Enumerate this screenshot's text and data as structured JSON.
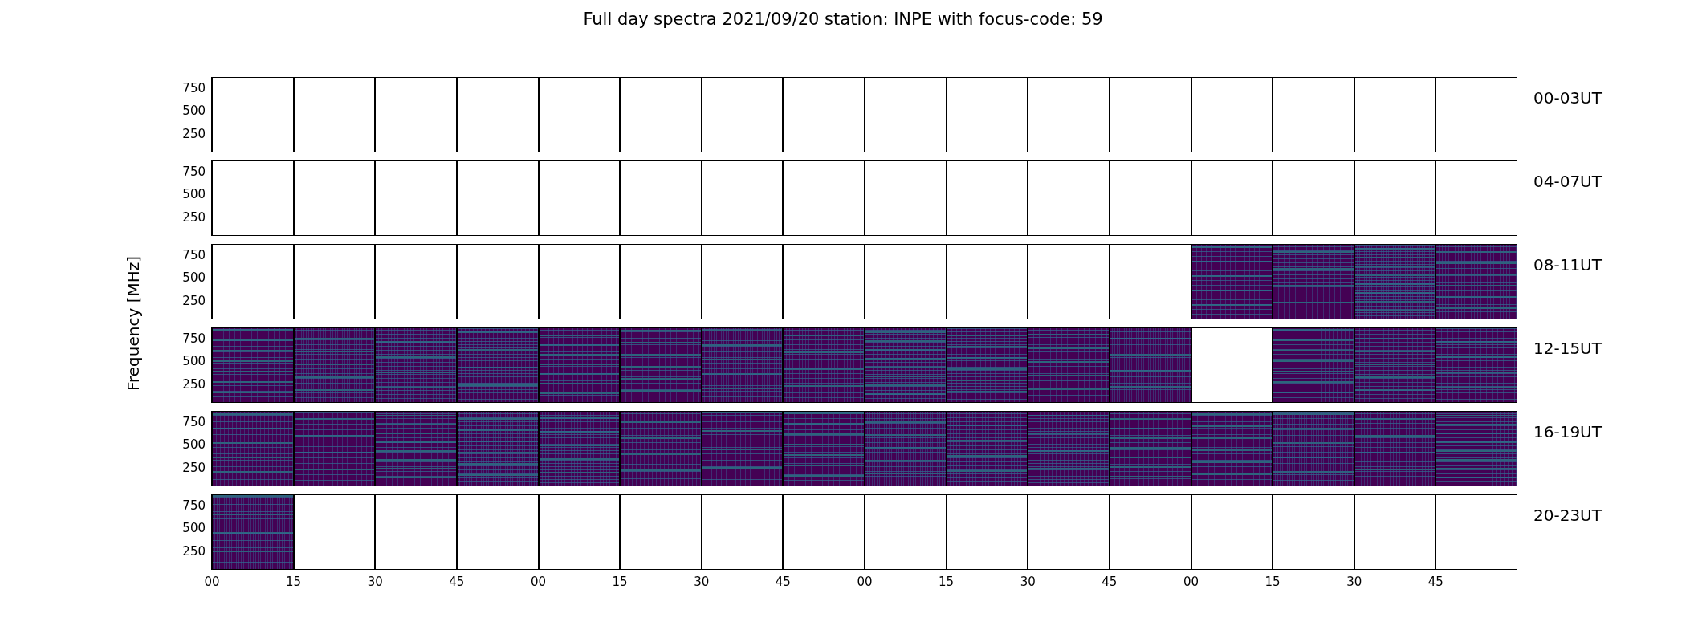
{
  "title": "Full day spectra 2021/09/20 station: INPE with focus-code: 59",
  "ylabel": "Frequency [MHz]",
  "xticks": [
    "00",
    "15",
    "30",
    "45",
    "00",
    "15",
    "30",
    "45",
    "00",
    "15",
    "30",
    "45",
    "00",
    "15",
    "30",
    "45"
  ],
  "rows": [
    {
      "label": "00-03UT",
      "yticks": [
        "750",
        "500",
        "250"
      ],
      "panels": [
        {
          "kind": "empty"
        },
        {
          "kind": "empty"
        },
        {
          "kind": "empty"
        },
        {
          "kind": "empty"
        },
        {
          "kind": "empty"
        },
        {
          "kind": "empty"
        },
        {
          "kind": "empty"
        },
        {
          "kind": "empty"
        },
        {
          "kind": "empty"
        },
        {
          "kind": "empty"
        },
        {
          "kind": "empty"
        },
        {
          "kind": "empty"
        },
        {
          "kind": "empty"
        },
        {
          "kind": "empty"
        },
        {
          "kind": "empty"
        },
        {
          "kind": "empty"
        }
      ]
    },
    {
      "label": "04-07UT",
      "yticks": [
        "750",
        "500",
        "250"
      ],
      "panels": [
        {
          "kind": "empty"
        },
        {
          "kind": "empty"
        },
        {
          "kind": "empty"
        },
        {
          "kind": "empty"
        },
        {
          "kind": "empty"
        },
        {
          "kind": "empty"
        },
        {
          "kind": "empty"
        },
        {
          "kind": "empty"
        },
        {
          "kind": "empty"
        },
        {
          "kind": "empty"
        },
        {
          "kind": "empty"
        },
        {
          "kind": "empty"
        },
        {
          "kind": "empty"
        },
        {
          "kind": "empty"
        },
        {
          "kind": "empty"
        },
        {
          "kind": "empty"
        }
      ]
    },
    {
      "label": "08-11UT",
      "yticks": [
        "750",
        "500",
        "250"
      ],
      "panels": [
        {
          "kind": "empty"
        },
        {
          "kind": "empty"
        },
        {
          "kind": "empty"
        },
        {
          "kind": "empty"
        },
        {
          "kind": "empty"
        },
        {
          "kind": "empty"
        },
        {
          "kind": "empty"
        },
        {
          "kind": "empty"
        },
        {
          "kind": "empty"
        },
        {
          "kind": "empty"
        },
        {
          "kind": "empty"
        },
        {
          "kind": "empty"
        },
        {
          "kind": "spectrogram"
        },
        {
          "kind": "spectrogram"
        },
        {
          "kind": "spectrogram"
        },
        {
          "kind": "spectrogram"
        }
      ]
    },
    {
      "label": "12-15UT",
      "yticks": [
        "750",
        "500",
        "250"
      ],
      "panels": [
        {
          "kind": "spectrogram"
        },
        {
          "kind": "spectrogram"
        },
        {
          "kind": "spectrogram"
        },
        {
          "kind": "spectrogram"
        },
        {
          "kind": "spectrogram"
        },
        {
          "kind": "spectrogram"
        },
        {
          "kind": "spectrogram"
        },
        {
          "kind": "spectrogram"
        },
        {
          "kind": "spectrogram"
        },
        {
          "kind": "spectrogram"
        },
        {
          "kind": "spectrogram"
        },
        {
          "kind": "spectrogram"
        },
        {
          "kind": "empty"
        },
        {
          "kind": "spectrogram"
        },
        {
          "kind": "spectrogram"
        },
        {
          "kind": "spectrogram"
        }
      ]
    },
    {
      "label": "16-19UT",
      "yticks": [
        "750",
        "500",
        "250"
      ],
      "panels": [
        {
          "kind": "spectrogram"
        },
        {
          "kind": "spectrogram"
        },
        {
          "kind": "spectrogram"
        },
        {
          "kind": "spectrogram"
        },
        {
          "kind": "spectrogram"
        },
        {
          "kind": "spectrogram"
        },
        {
          "kind": "spectrogram"
        },
        {
          "kind": "spectrogram"
        },
        {
          "kind": "spectrogram"
        },
        {
          "kind": "spectrogram"
        },
        {
          "kind": "spectrogram"
        },
        {
          "kind": "spectrogram"
        },
        {
          "kind": "spectrogram"
        },
        {
          "kind": "spectrogram"
        },
        {
          "kind": "spectrogram"
        },
        {
          "kind": "spectrogram"
        }
      ]
    },
    {
      "label": "20-23UT",
      "yticks": [
        "750",
        "500",
        "250"
      ],
      "panels": [
        {
          "kind": "spectrogram"
        },
        {
          "kind": "empty"
        },
        {
          "kind": "empty"
        },
        {
          "kind": "empty"
        },
        {
          "kind": "empty"
        },
        {
          "kind": "empty"
        },
        {
          "kind": "empty"
        },
        {
          "kind": "empty"
        },
        {
          "kind": "empty"
        },
        {
          "kind": "empty"
        },
        {
          "kind": "empty"
        },
        {
          "kind": "empty"
        },
        {
          "kind": "empty"
        },
        {
          "kind": "empty"
        },
        {
          "kind": "empty"
        },
        {
          "kind": "empty"
        }
      ]
    }
  ]
}
